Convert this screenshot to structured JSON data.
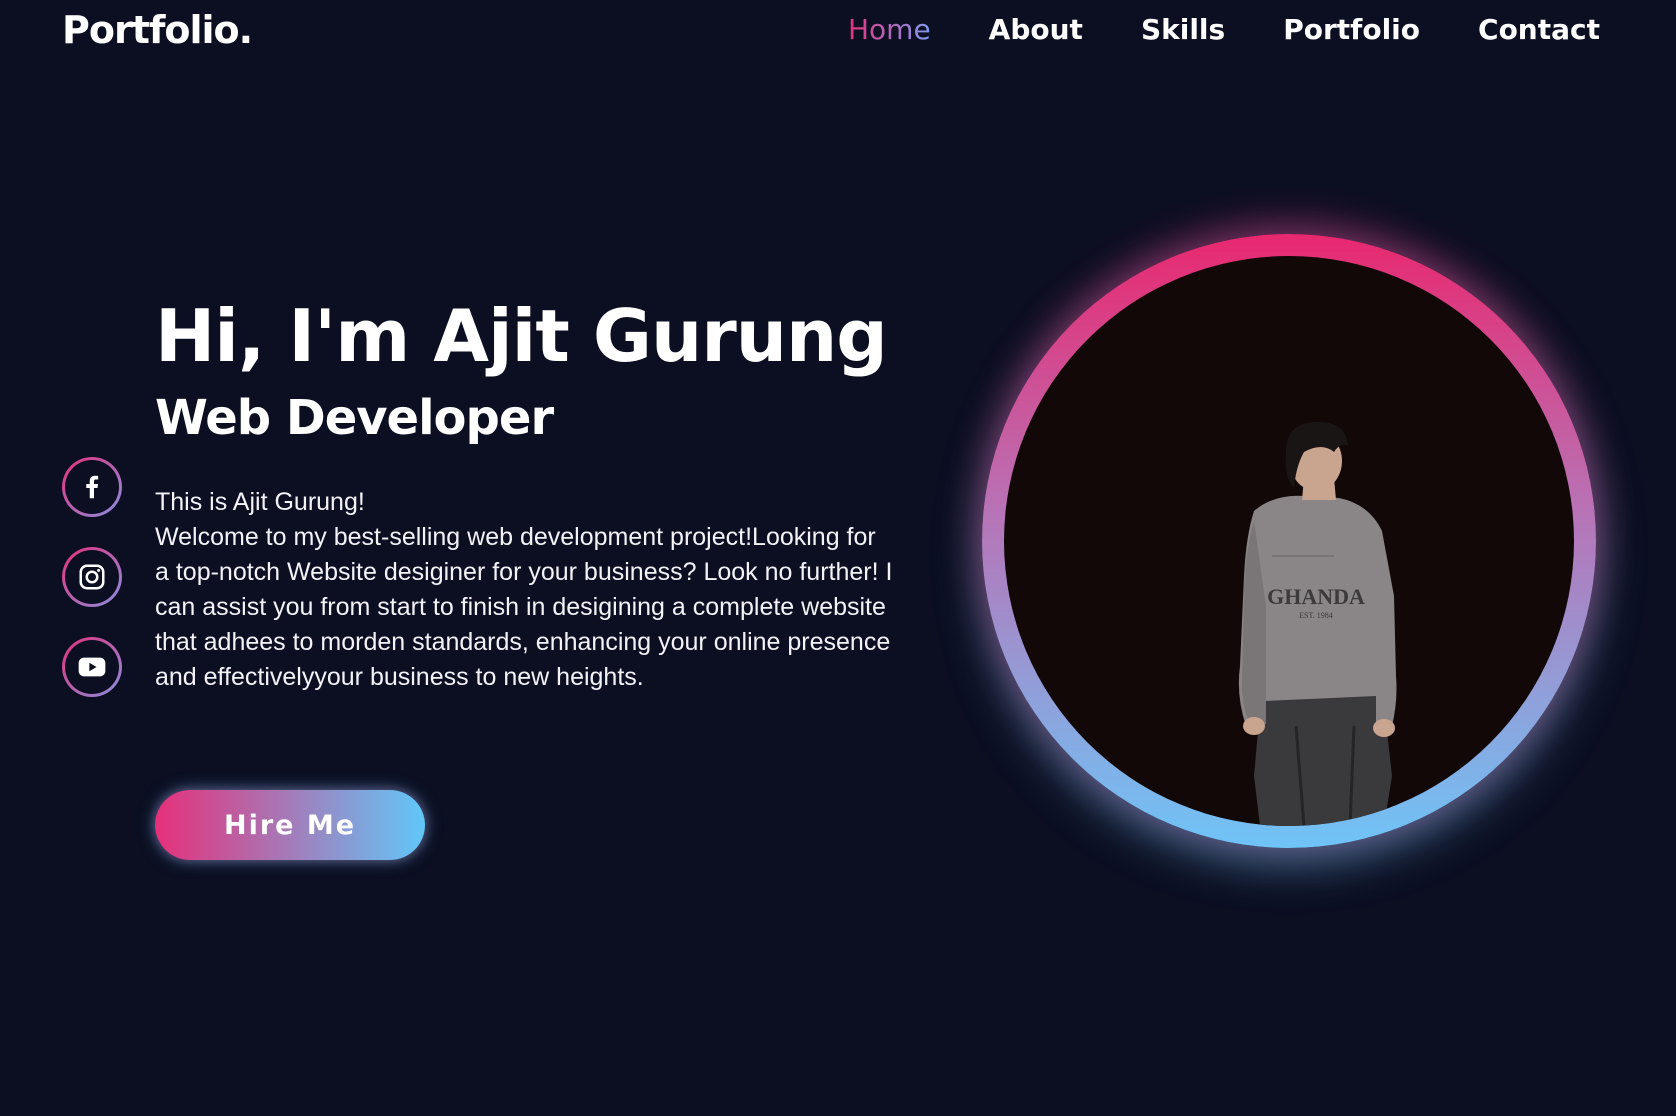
{
  "header": {
    "logo": "Portfolio."
  },
  "nav": {
    "items": [
      {
        "label": "Home",
        "active": true
      },
      {
        "label": "About",
        "active": false
      },
      {
        "label": "Skills",
        "active": false
      },
      {
        "label": "Portfolio",
        "active": false
      },
      {
        "label": "Contact",
        "active": false
      }
    ]
  },
  "socials": [
    {
      "icon": "facebook-icon"
    },
    {
      "icon": "instagram-icon"
    },
    {
      "icon": "youtube-icon"
    }
  ],
  "hero": {
    "title": "Hi, I'm Ajit Gurung",
    "subtitle": "Web Developer",
    "intro": "This is Ajit Gurung!",
    "description": "Welcome to my best-selling web development project!Looking for a top-notch Website desiginer for your business? Look no further! I can assist you from start to finish in desigining a complete website that adhees to morden standards, enhancing your online presence and effectivelyyour business to new heights.",
    "button_label": "Hire Me"
  },
  "profile": {
    "shirt_text": "GHANDA"
  },
  "colors": {
    "background": "#0c0f22",
    "accent_pink": "#e6307a",
    "accent_blue": "#61c7f8"
  }
}
